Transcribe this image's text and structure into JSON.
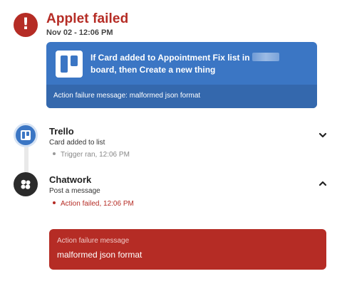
{
  "header": {
    "alert_glyph": "!",
    "title": "Applet failed",
    "timestamp": "Nov 02 - 12:06 PM"
  },
  "applet_card": {
    "line1": "If Card added to Appointment Fix list in",
    "line2": "board, then Create a new thing",
    "footer": "Action failure message: malformed json format"
  },
  "steps": [
    {
      "service": "Trello",
      "description": "Card added to list",
      "status": "Trigger ran, 12:06 PM",
      "status_color": "#888888",
      "expanded": false
    },
    {
      "service": "Chatwork",
      "description": "Post a message",
      "status": "Action failed, 12:06 PM",
      "status_color": "#b52c25",
      "expanded": true
    }
  ],
  "failure": {
    "label": "Action failure message",
    "message": "malformed json format"
  },
  "colors": {
    "error_red": "#b52c25",
    "trello_blue": "#3b76c4",
    "chatwork_dark": "#2b2b2b"
  }
}
